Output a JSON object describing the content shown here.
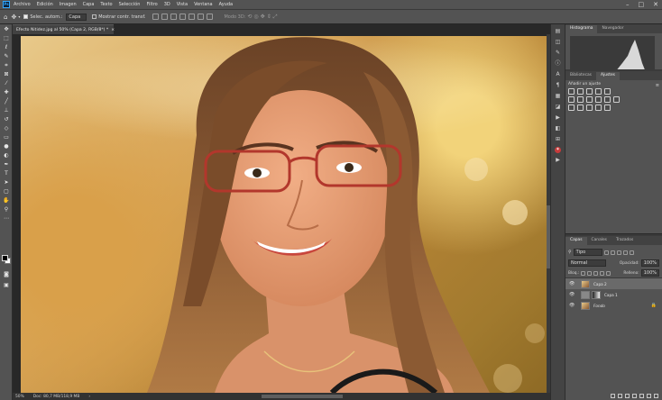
{
  "app": {
    "logo": "Ps",
    "menu": [
      "Archivo",
      "Edición",
      "Imagen",
      "Capa",
      "Texto",
      "Selección",
      "Filtro",
      "3D",
      "Vista",
      "Ventana",
      "Ayuda"
    ]
  },
  "window_controls": [
    "–",
    "□",
    "✕"
  ],
  "options_bar": {
    "auto_select_label": "Selec. autom.:",
    "auto_select_value": "Capa",
    "transform_label": "Mostrar contr. transf.",
    "mode_3d": "Modo 3D:"
  },
  "document": {
    "tab_title": "Efecto Nitidez.jpg al 50% (Capa 2, RGB/8*) *",
    "close": "×"
  },
  "status": {
    "zoom": "50%",
    "doc": "Doc: 80,7 MB/118,9 MB",
    "arrow": "›"
  },
  "panels": {
    "top_tabs": [
      "Histograma",
      "Navegador"
    ],
    "adjust_tabs": [
      "Bibliotecas",
      "Ajustes"
    ],
    "adjust_title": "Añadir un ajuste",
    "layer_tabs": [
      "Capas",
      "Canales",
      "Trazados"
    ],
    "filter_kind": "Tipo",
    "blend_mode": "Normal",
    "opacity_label": "Opacidad:",
    "opacity_value": "100%",
    "lock_label": "Bloq.:",
    "fill_label": "Relleno:",
    "fill_value": "100%"
  },
  "layers": [
    {
      "name": "Capa 2",
      "selected": true
    },
    {
      "name": "Capa 1",
      "selected": false
    },
    {
      "name": "Fondo",
      "selected": false
    }
  ],
  "tools": [
    "move-icon",
    "marquee-icon",
    "lasso-icon",
    "quick-select-icon",
    "crop-icon",
    "frame-icon",
    "eyedropper-icon",
    "heal-icon",
    "brush-icon",
    "stamp-icon",
    "history-brush-icon",
    "eraser-icon",
    "gradient-icon",
    "blur-icon",
    "dodge-icon",
    "pen-icon",
    "type-icon",
    "path-select-icon",
    "rectangle-icon",
    "hand-icon",
    "zoom-icon",
    "more-icon"
  ],
  "colors": {
    "accent": "#31a8ff",
    "foreground": "#000000",
    "background": "#ffffff"
  }
}
